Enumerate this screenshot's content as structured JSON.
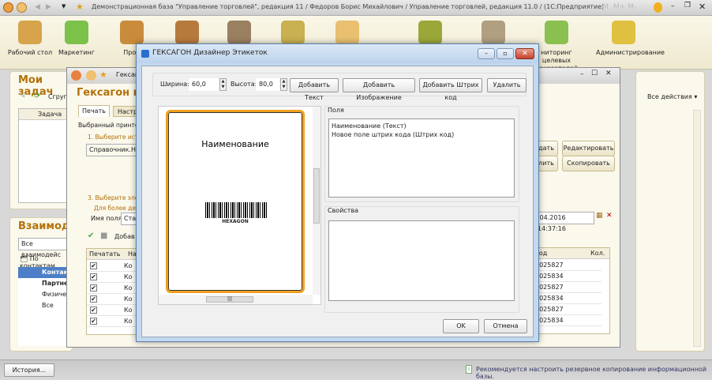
{
  "titlebar": {
    "title": "Демонстрационная база \"Управление торговлей\", редакция 11 / Федоров Борис Михайлович / Управление торговлей, редакция 11.0 /  (1С:Предприятие)",
    "m": "M",
    "mplus": "M+",
    "mminus": "M-"
  },
  "ribbon": [
    {
      "label": "Рабочий стол",
      "color": "#d7a44c"
    },
    {
      "label": "Маркетинг",
      "color": "#7cc14a"
    },
    {
      "label": "Прод",
      "color": "#c98c3c"
    },
    {
      "label": "",
      "color": "#b77a3d"
    },
    {
      "label": "",
      "color": "#9a8060"
    },
    {
      "label": "",
      "color": "#c9b050"
    },
    {
      "label": "",
      "color": "#e8c070"
    },
    {
      "label": "",
      "color": "#9aa83a"
    },
    {
      "label": "",
      "color": "#b0a080"
    },
    {
      "label": "ниторинг целевых показателей",
      "color": "#8ac050"
    },
    {
      "label": "Администрирование",
      "color": "#e0c040"
    }
  ],
  "tasks": {
    "title": "Мои задач",
    "group_btn": "Сгруп",
    "col_task": "Задача"
  },
  "interactions": {
    "title": "Взаимодей",
    "filter": "Все взаимодейс",
    "by_contacts": "По контактам",
    "tree": [
      {
        "label": "Контак",
        "selected": true
      },
      {
        "label": "Партне",
        "bold": true
      },
      {
        "label": "Физиче"
      },
      {
        "label": "Все"
      }
    ]
  },
  "inner": {
    "title": "Гексаг",
    "header": "Гексагон печ",
    "tabs": [
      "Печать",
      "Настр"
    ],
    "printer": "Выбранный принтер",
    "step1": "1. Выберите ист",
    "source": "Справочник.Номе",
    "step3": "3. Выберите эле",
    "detail": "Для более дета",
    "field_label": "Имя поля:",
    "field_value": "Стар",
    "add": "Добав",
    "col_print": "Печатать",
    "col_name": "На",
    "rows": [
      {
        "name": "Ко",
        "code": "0025827"
      },
      {
        "name": "Ко",
        "code": "0025834"
      },
      {
        "name": "Ко",
        "code": "0025827"
      },
      {
        "name": "Ко",
        "code": "0025834"
      },
      {
        "name": "Ко",
        "code": "0025827"
      },
      {
        "name": "Ко",
        "code": "0025834"
      }
    ],
    "btn_create": "дать",
    "btn_edit": "Редактировать",
    "btn_delete": "лить",
    "btn_copy": "Скопировать",
    "date": ".04.2016 14:37:16",
    "col_code": "код",
    "col_qty": "Кол."
  },
  "all_actions": "Все действия ▾",
  "dialog": {
    "title": "ГЕКСАГОН Дизайнер Этикеток",
    "width_label": "Ширина:",
    "width": "60,0",
    "height_label": "Высота:",
    "height": "80,0",
    "add_text": "Добавить Текст",
    "add_image": "Добавить Изображение",
    "add_barcode": "Добавить Штрих код",
    "delete": "Удалить",
    "label_text": "Наименование",
    "barcode_text": "HEXAGON",
    "fields_title": "Поля",
    "fields": [
      "Наименование (Текст)",
      "Новое поле штрих кода (Штрих код)"
    ],
    "props_title": "Свойства",
    "ok": "OK",
    "cancel": "Отмена"
  },
  "status": {
    "history": "История...",
    "message": "Рекомендуется настроить резервное копирование информационной базы."
  }
}
